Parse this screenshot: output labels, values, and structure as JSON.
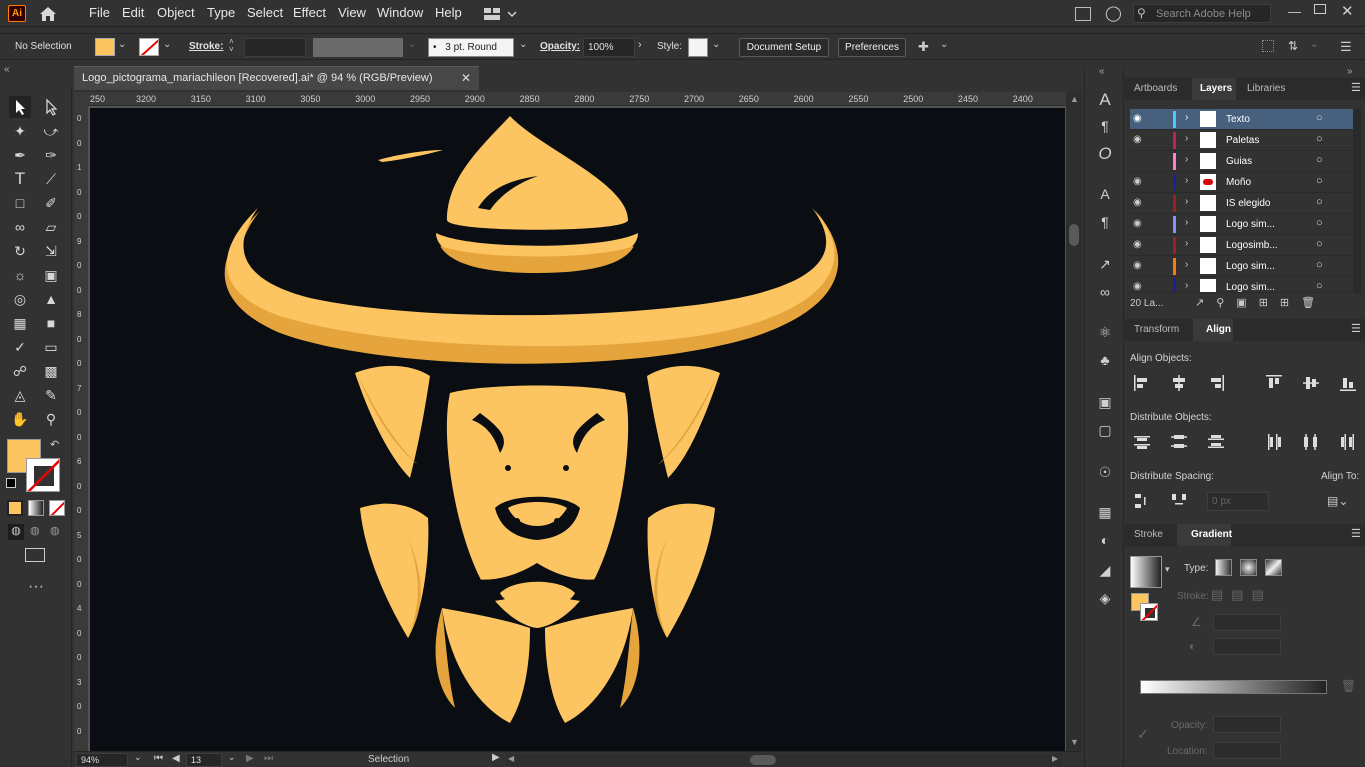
{
  "app": {
    "logo": "Ai"
  },
  "menu": [
    "File",
    "Edit",
    "Object",
    "Type",
    "Select",
    "Effect",
    "View",
    "Window",
    "Help"
  ],
  "search": {
    "placeholder": "Search Adobe Help"
  },
  "control": {
    "selection": "No Selection",
    "stroke_label": "Stroke:",
    "brush": "3 pt. Round",
    "opacity_label": "Opacity:",
    "opacity": "100%",
    "style_label": "Style:",
    "document_setup": "Document Setup",
    "preferences": "Preferences"
  },
  "document": {
    "tab_title": "Logo_pictograma_mariachileon [Recovered].ai* @ 94 % (RGB/Preview)"
  },
  "ruler": {
    "top": [
      "250",
      "3200",
      "3150",
      "3100",
      "3050",
      "3000",
      "2950",
      "2900",
      "2850",
      "2800",
      "2750",
      "2700",
      "2650",
      "2600",
      "2550",
      "2500",
      "2450",
      "2400"
    ],
    "left": [
      "0",
      "0",
      "1",
      "0",
      "0",
      "9",
      "0",
      "0",
      "8",
      "0",
      "0",
      "7",
      "0",
      "0",
      "6",
      "0",
      "0",
      "5",
      "0",
      "0",
      "4",
      "0",
      "0",
      "3",
      "0",
      "0"
    ]
  },
  "status": {
    "zoom": "94%",
    "artboard": "13",
    "tool": "Selection"
  },
  "colors": {
    "fill": "#fdc561",
    "fill_dark": "#e6a43c",
    "artboard_bg": "#0a0d12",
    "selected_layer": "#46607e"
  },
  "panels": {
    "top_tabs": [
      "Artboards",
      "Layers",
      "Libraries"
    ],
    "layers": [
      {
        "name": "Texto",
        "color": "#4ec9ff"
      },
      {
        "name": "Paletas",
        "color": "#c0224a"
      },
      {
        "name": "Guias",
        "color": "#ff80c0"
      },
      {
        "name": "Moño",
        "color": "#1f1f9e"
      },
      {
        "name": "IS elegido",
        "color": "#9e1f1f"
      },
      {
        "name": "Logo sim...",
        "color": "#8c8cff"
      },
      {
        "name": "Logosimb...",
        "color": "#9e1f1f"
      },
      {
        "name": "Logo sim...",
        "color": "#ff7a00"
      },
      {
        "name": "Logo sim...",
        "color": "#1f1f9e"
      }
    ],
    "layers_count": "20 La...",
    "mid_tabs": [
      "Transform",
      "Align"
    ],
    "align_objects": "Align Objects:",
    "distribute_objects": "Distribute Objects:",
    "distribute_spacing": "Distribute Spacing:",
    "align_to": "Align To:",
    "spacing_value": "0 px",
    "bottom_tabs": [
      "Stroke",
      "Gradient"
    ],
    "type_label": "Type:",
    "stroke_label": "Stroke:",
    "opacity_label": "Opacity:",
    "location_label": "Location:"
  }
}
